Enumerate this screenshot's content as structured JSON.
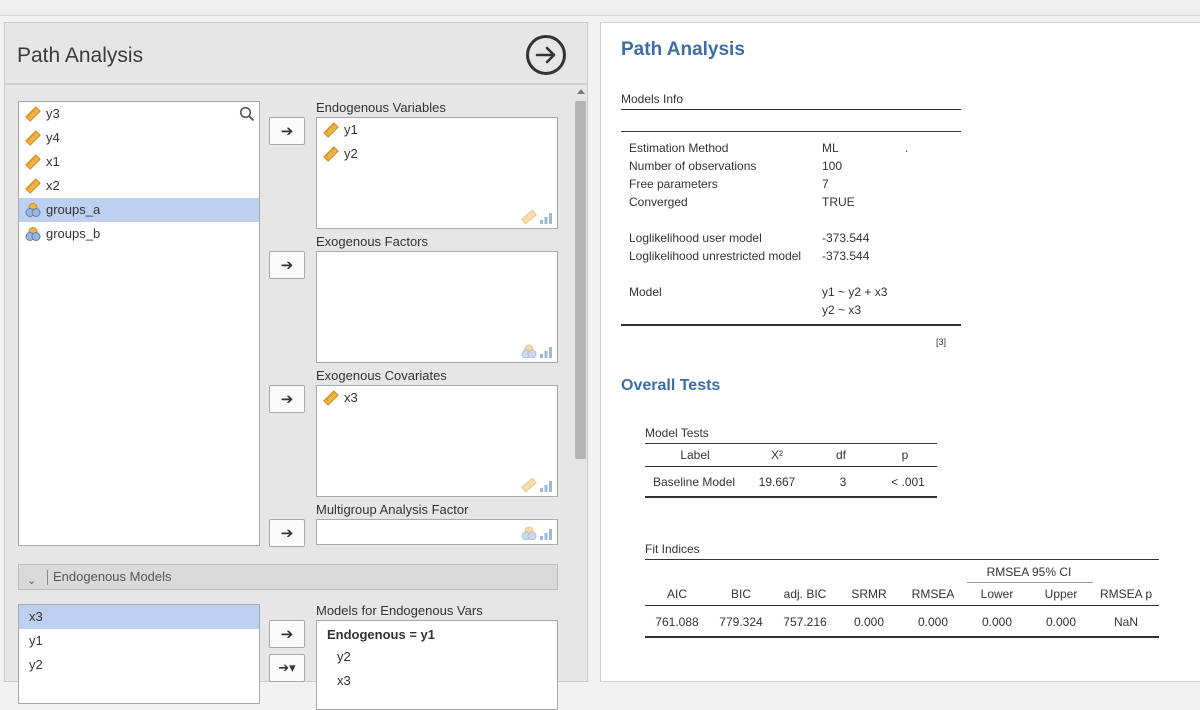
{
  "options_panel": {
    "title": "Path Analysis",
    "variables": [
      {
        "name": "y3",
        "type": "continuous",
        "selected": false
      },
      {
        "name": "y4",
        "type": "continuous",
        "selected": false
      },
      {
        "name": "x1",
        "type": "continuous",
        "selected": false
      },
      {
        "name": "x2",
        "type": "continuous",
        "selected": false
      },
      {
        "name": "groups_a",
        "type": "nominal",
        "selected": true
      },
      {
        "name": "groups_b",
        "type": "nominal",
        "selected": false
      }
    ],
    "endogenous_variables": {
      "label": "Endogenous Variables",
      "items": [
        "y1",
        "y2"
      ]
    },
    "exogenous_factors": {
      "label": "Exogenous Factors",
      "items": []
    },
    "exogenous_covariates": {
      "label": "Exogenous Covariates",
      "items": [
        "x3"
      ]
    },
    "multigroup_factor": {
      "label": "Multigroup Analysis Factor"
    },
    "endogenous_models_section": "Endogenous Models",
    "endo_list": [
      {
        "name": "x3",
        "selected": true
      },
      {
        "name": "y1",
        "selected": false
      },
      {
        "name": "y2",
        "selected": false
      }
    ],
    "models_for_endogenous": {
      "label": "Models for Endogenous Vars",
      "header": "Endogenous = y1",
      "terms": [
        "y2",
        "x3"
      ]
    }
  },
  "results": {
    "title": "Path Analysis",
    "models_info": {
      "caption": "Models Info",
      "rows": [
        {
          "label": "Estimation Method",
          "value": "ML",
          "extra": "."
        },
        {
          "label": "Number of observations",
          "value": "100"
        },
        {
          "label": "Free parameters",
          "value": "7"
        },
        {
          "label": "Converged",
          "value": "TRUE"
        },
        {
          "label": "Loglikelihood user model",
          "value": "-373.544"
        },
        {
          "label": "Loglikelihood unrestricted model",
          "value": "-373.544"
        },
        {
          "label": "Model",
          "value": "y1 ~ y2 + x3",
          "value2": "y2 ~ x3"
        }
      ],
      "note": "[3]"
    },
    "overall_tests_title": "Overall Tests",
    "model_tests": {
      "caption": "Model Tests",
      "headers": [
        "Label",
        "X²",
        "df",
        "p"
      ],
      "rows": [
        [
          "Baseline Model",
          "19.667",
          "3",
          "< .001"
        ]
      ]
    },
    "fit_indices": {
      "caption": "Fit Indices",
      "ci_header": "RMSEA 95% CI",
      "headers": [
        "AIC",
        "BIC",
        "adj. BIC",
        "SRMR",
        "RMSEA",
        "Lower",
        "Upper",
        "RMSEA p"
      ],
      "rows": [
        [
          "761.088",
          "779.324",
          "757.216",
          "0.000",
          "0.000",
          "0.000",
          "0.000",
          "NaN"
        ]
      ]
    }
  },
  "colors": {
    "accent": "#3e6da6",
    "selection": "#bed0ef",
    "ruler": "#f0b444"
  }
}
